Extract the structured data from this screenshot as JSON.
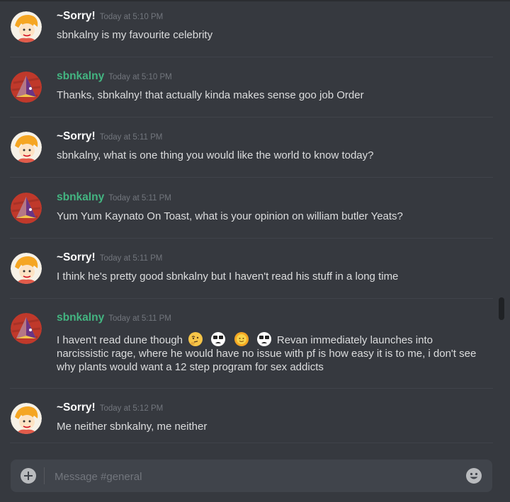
{
  "composer": {
    "placeholder": "Message #general"
  },
  "messages": [
    {
      "username": "~Sorry!",
      "timestamp": "Today at 5:10 PM",
      "text": "sbnkalny is my favourite celebrity",
      "avatar": "sorry-avatar"
    },
    {
      "username": "sbnkalny",
      "timestamp": "Today at 5:10 PM",
      "text": "Thanks, sbnkalny! that actually kinda makes sense goo job Order",
      "avatar": "sbnkalny-avatar",
      "name_color": "#43b581"
    },
    {
      "username": "~Sorry!",
      "timestamp": "Today at 5:11 PM",
      "text": "sbnkalny, what is one thing you would like the world to know today?",
      "avatar": "sorry-avatar"
    },
    {
      "username": "sbnkalny",
      "timestamp": "Today at 5:11 PM",
      "text": "Yum Yum Kaynato On Toast, what is your opinion on william butler Yeats?",
      "avatar": "sbnkalny-avatar",
      "name_color": "#43b581"
    },
    {
      "username": "~Sorry!",
      "timestamp": "Today at 5:11 PM",
      "text": "I think he's pretty good sbnkalny but I haven't read his stuff in a long time",
      "avatar": "sorry-avatar"
    },
    {
      "username": "sbnkalny",
      "timestamp": "Today at 5:11 PM",
      "text_before": "I haven't read dune though",
      "emojis": [
        "thinking-face-emoji",
        "worried-face-emoji",
        "sun-with-face-emoji",
        "worried-face-emoji"
      ],
      "text_after": "Revan immediately launches into narcissistic rage, where he would have no issue with pf is how easy it is to me, i don't see why plants would want a 12 step program for sex addicts",
      "avatar": "sbnkalny-avatar",
      "name_color": "#43b581"
    },
    {
      "username": "~Sorry!",
      "timestamp": "Today at 5:12 PM",
      "text": "Me neither sbnkalny, me neither",
      "avatar": "sorry-avatar"
    }
  ]
}
